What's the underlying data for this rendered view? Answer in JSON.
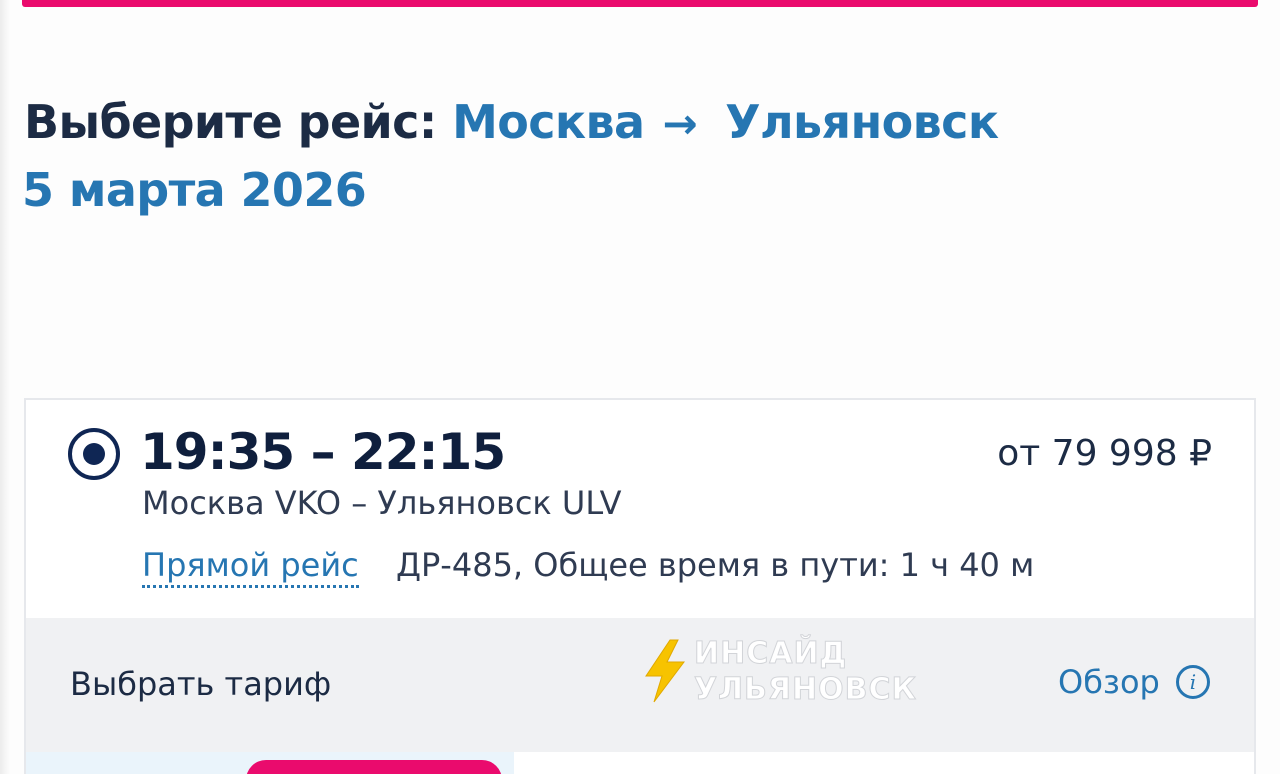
{
  "header": {
    "prefix": "Выберите рейс:",
    "origin": "Москва",
    "arrow": "→",
    "destination": "Ульяновск",
    "date": "5 марта 2026"
  },
  "flight": {
    "time": "19:35 – 22:15",
    "price": "от 79 998 ₽",
    "route": "Москва VKO – Ульяновск ULV",
    "direct_label": "Прямой рейс",
    "info": "ДР-485, Общее время в пути: 1 ч 40 м",
    "selected": true
  },
  "tariff": {
    "label": "Выбрать тариф",
    "overview_label": "Обзор",
    "info_icon": "i"
  },
  "watermark": {
    "line1": "ИНСАЙД",
    "line2": "УЛЬЯНОВСК"
  },
  "colors": {
    "accent": "#ea0b6d",
    "blue": "#2676b2",
    "navy": "#0f2654"
  }
}
